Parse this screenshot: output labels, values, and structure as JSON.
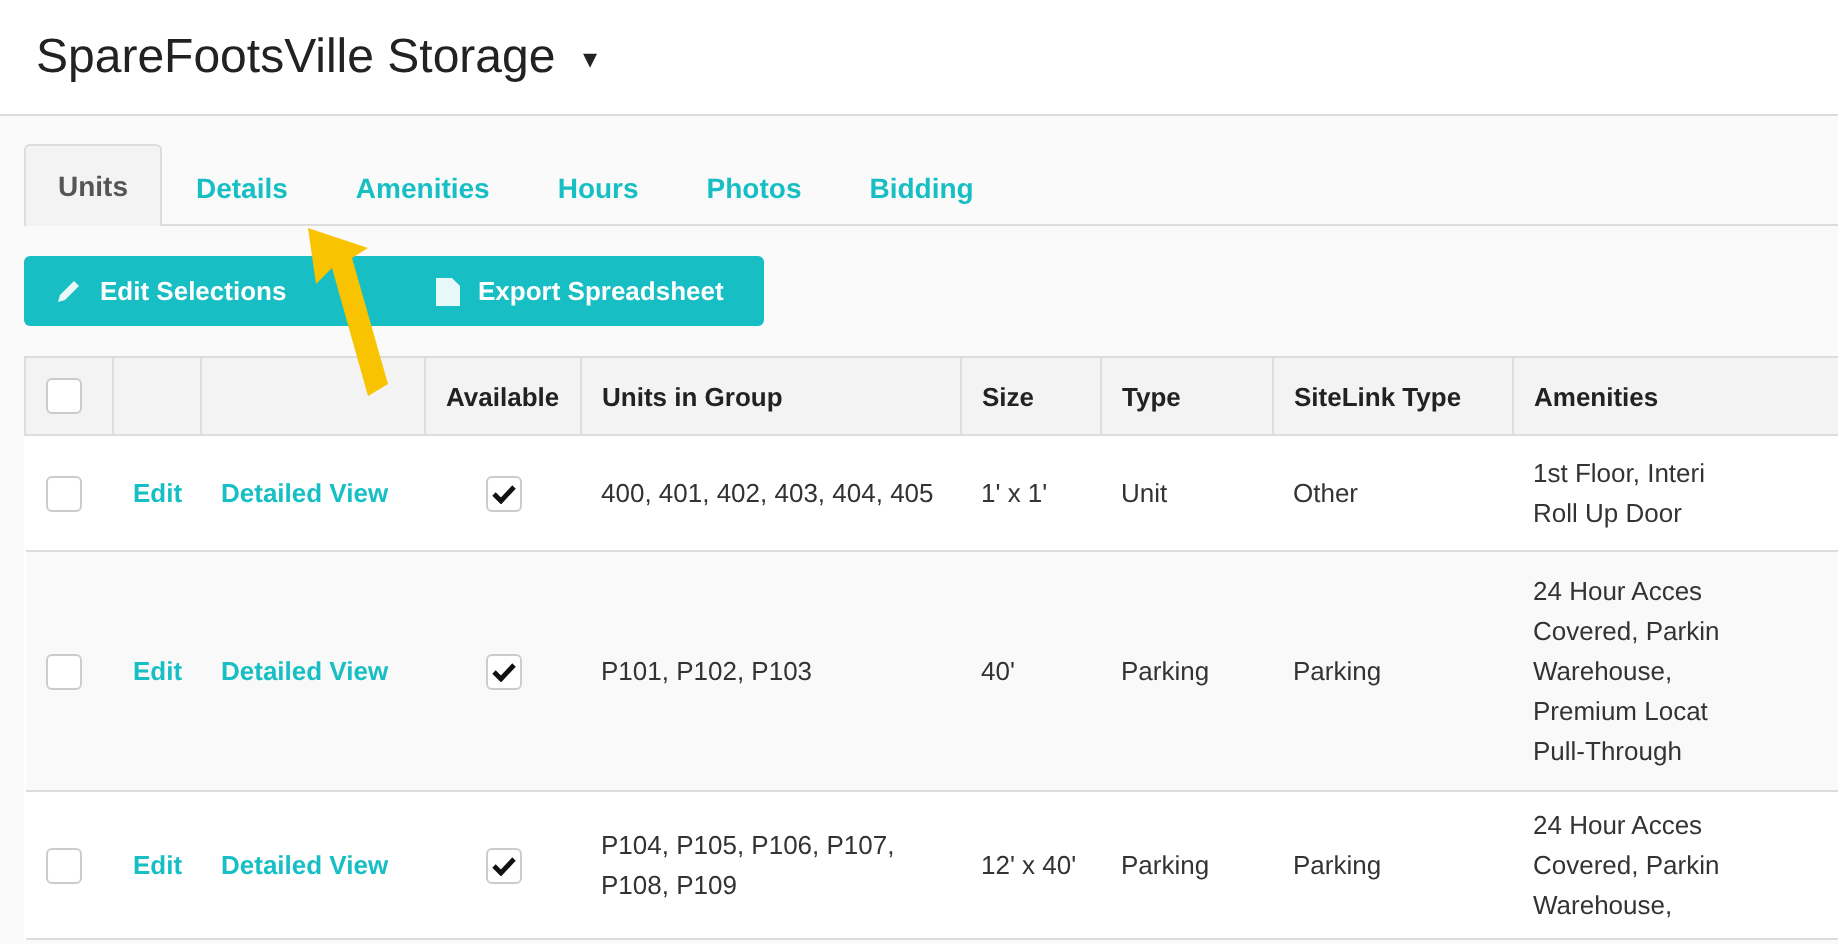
{
  "header": {
    "title": "SpareFootsVille Storage",
    "caret": "▾"
  },
  "tabs": [
    {
      "label": "Units",
      "selected": true
    },
    {
      "label": "Details",
      "selected": false
    },
    {
      "label": "Amenities",
      "selected": false
    },
    {
      "label": "Hours",
      "selected": false
    },
    {
      "label": "Photos",
      "selected": false
    },
    {
      "label": "Bidding",
      "selected": false
    }
  ],
  "actions": [
    {
      "label": "Edit Selections",
      "kind": "pencil"
    },
    {
      "label": "Export Spreadsheet",
      "kind": "file"
    }
  ],
  "table": {
    "header_selected": false,
    "columns": [
      "Available",
      "Units in Group",
      "Size",
      "Type",
      "SiteLink Type",
      "Amenities"
    ],
    "rows": [
      {
        "selected": false,
        "edit": "Edit",
        "view": "Detailed View",
        "available": true,
        "units": "400, 401, 402, 403, 404, 405",
        "size": "1' x 1'",
        "type": "Unit",
        "sitelink_type": "Other",
        "amenities": [
          "1st Floor, Interi",
          "Roll Up Door"
        ]
      },
      {
        "selected": false,
        "edit": "Edit",
        "view": "Detailed View",
        "available": true,
        "units": "P101, P102, P103",
        "size": "40'",
        "type": "Parking",
        "sitelink_type": "Parking",
        "amenities": [
          "24 Hour Acces",
          "Covered, Parkin",
          "Warehouse,",
          "Premium Locat",
          "Pull-Through"
        ]
      },
      {
        "selected": false,
        "edit": "Edit",
        "view": "Detailed View",
        "available": true,
        "units": "P104, P105, P106, P107,\nP108, P109",
        "size": "12' x 40'",
        "type": "Parking",
        "sitelink_type": "Parking",
        "amenities": [
          "24 Hour Acces",
          "Covered, Parkin",
          "Warehouse,"
        ]
      }
    ]
  }
}
